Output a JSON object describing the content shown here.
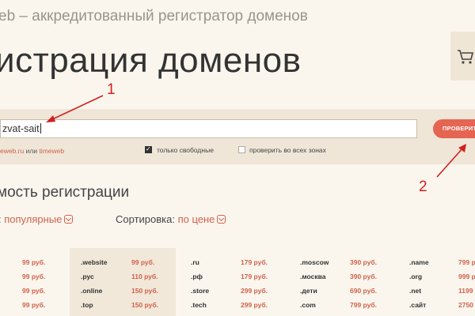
{
  "header": {
    "tagline": "eb – аккредитованный регистратор доменов",
    "title": "истрация доменов"
  },
  "search": {
    "value": "zvat-sait",
    "button_label": "ПРОВЕРИТЬ",
    "hint_prefix": "eweb.ru",
    "hint_mid": " или ",
    "hint_link": "timeweb",
    "only_free_label": "только свободные",
    "only_free_checked": true,
    "all_zones_label": "проверить во всех зонах",
    "all_zones_checked": false
  },
  "pricing": {
    "section_title": "мость регистрации",
    "filter_label": ":",
    "filter_value": "популярные",
    "sort_label": "Сортировка:",
    "sort_value": "по цене"
  },
  "columns": [
    {
      "rows": [
        {
          "zone": "",
          "price": "99 руб."
        },
        {
          "zone": "",
          "price": "99 руб."
        },
        {
          "zone": "",
          "price": "99 руб."
        },
        {
          "zone": "",
          "price": "99 руб."
        }
      ]
    },
    {
      "rows": [
        {
          "zone": ".website",
          "price": "99 руб."
        },
        {
          "zone": ".рус",
          "price": "110 руб."
        },
        {
          "zone": ".online",
          "price": "150 руб."
        },
        {
          "zone": ".top",
          "price": "150 руб."
        }
      ]
    },
    {
      "rows": [
        {
          "zone": ".ru",
          "price": "179 руб."
        },
        {
          "zone": ".рф",
          "price": "179 руб."
        },
        {
          "zone": ".store",
          "price": "299 руб."
        },
        {
          "zone": ".tech",
          "price": "299 руб."
        }
      ]
    },
    {
      "rows": [
        {
          "zone": ".moscow",
          "price": "390 руб."
        },
        {
          "zone": ".москва",
          "price": "390 руб."
        },
        {
          "zone": ".дети",
          "price": "690 руб."
        },
        {
          "zone": ".com",
          "price": "799 руб."
        }
      ]
    },
    {
      "rows": [
        {
          "zone": ".name",
          "price": "799 р"
        },
        {
          "zone": ".org",
          "price": "999 р"
        },
        {
          "zone": ".net",
          "price": "1199"
        },
        {
          "zone": ".сайт",
          "price": "2750"
        }
      ]
    }
  ],
  "annotations": {
    "first": "1",
    "second": "2",
    "color": "#d21f1f"
  },
  "colors": {
    "accent": "#e56552",
    "link": "#d0624b",
    "background": "#faf6ee"
  },
  "icons": {
    "cart": "cart-icon",
    "dropdown": "chevron-down-icon"
  }
}
